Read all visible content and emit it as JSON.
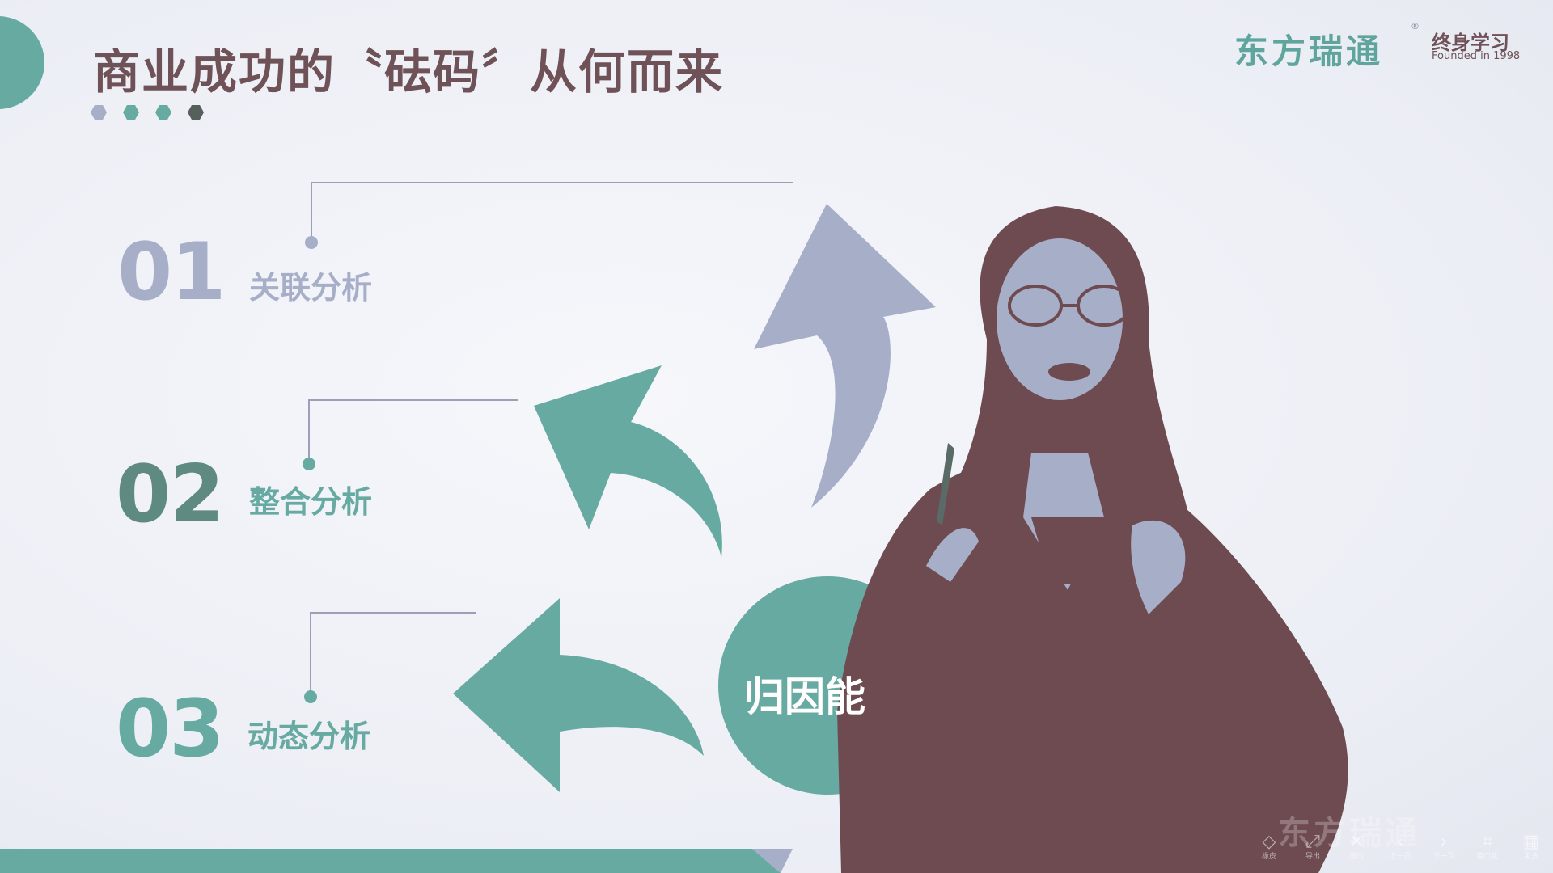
{
  "slide": {
    "title": "商业成功的〝砝码〞从何而来",
    "center_label": "归因能",
    "items": [
      {
        "number": "01",
        "label": "关联分析"
      },
      {
        "number": "02",
        "label": "整合分析"
      },
      {
        "number": "03",
        "label": "动态分析"
      }
    ],
    "colors": {
      "teal": "#67aaa2",
      "lavender": "#a7aec8",
      "maroon": "#6e4b50",
      "line": "#9aa0b8"
    }
  },
  "brand": {
    "name": "东方瑞通",
    "sub": "终身学习",
    "founded": "Founded in 1998",
    "reg": "®",
    "watermark": "东方瑞通"
  },
  "toolbar": [
    {
      "icon": "eraser-icon",
      "glyph": "◇",
      "label": "橡皮"
    },
    {
      "icon": "export-icon",
      "glyph": "⤢",
      "label": "导出"
    },
    {
      "icon": "close-icon",
      "glyph": "✕",
      "label": "退出"
    },
    {
      "icon": "prev-icon",
      "glyph": "‹",
      "label": "上一页"
    },
    {
      "icon": "next-icon",
      "glyph": "›",
      "label": "下一页"
    },
    {
      "icon": "window-icon",
      "glyph": "⌗",
      "label": "窗口化"
    },
    {
      "icon": "grid-icon",
      "glyph": "▦",
      "label": "更多"
    }
  ]
}
